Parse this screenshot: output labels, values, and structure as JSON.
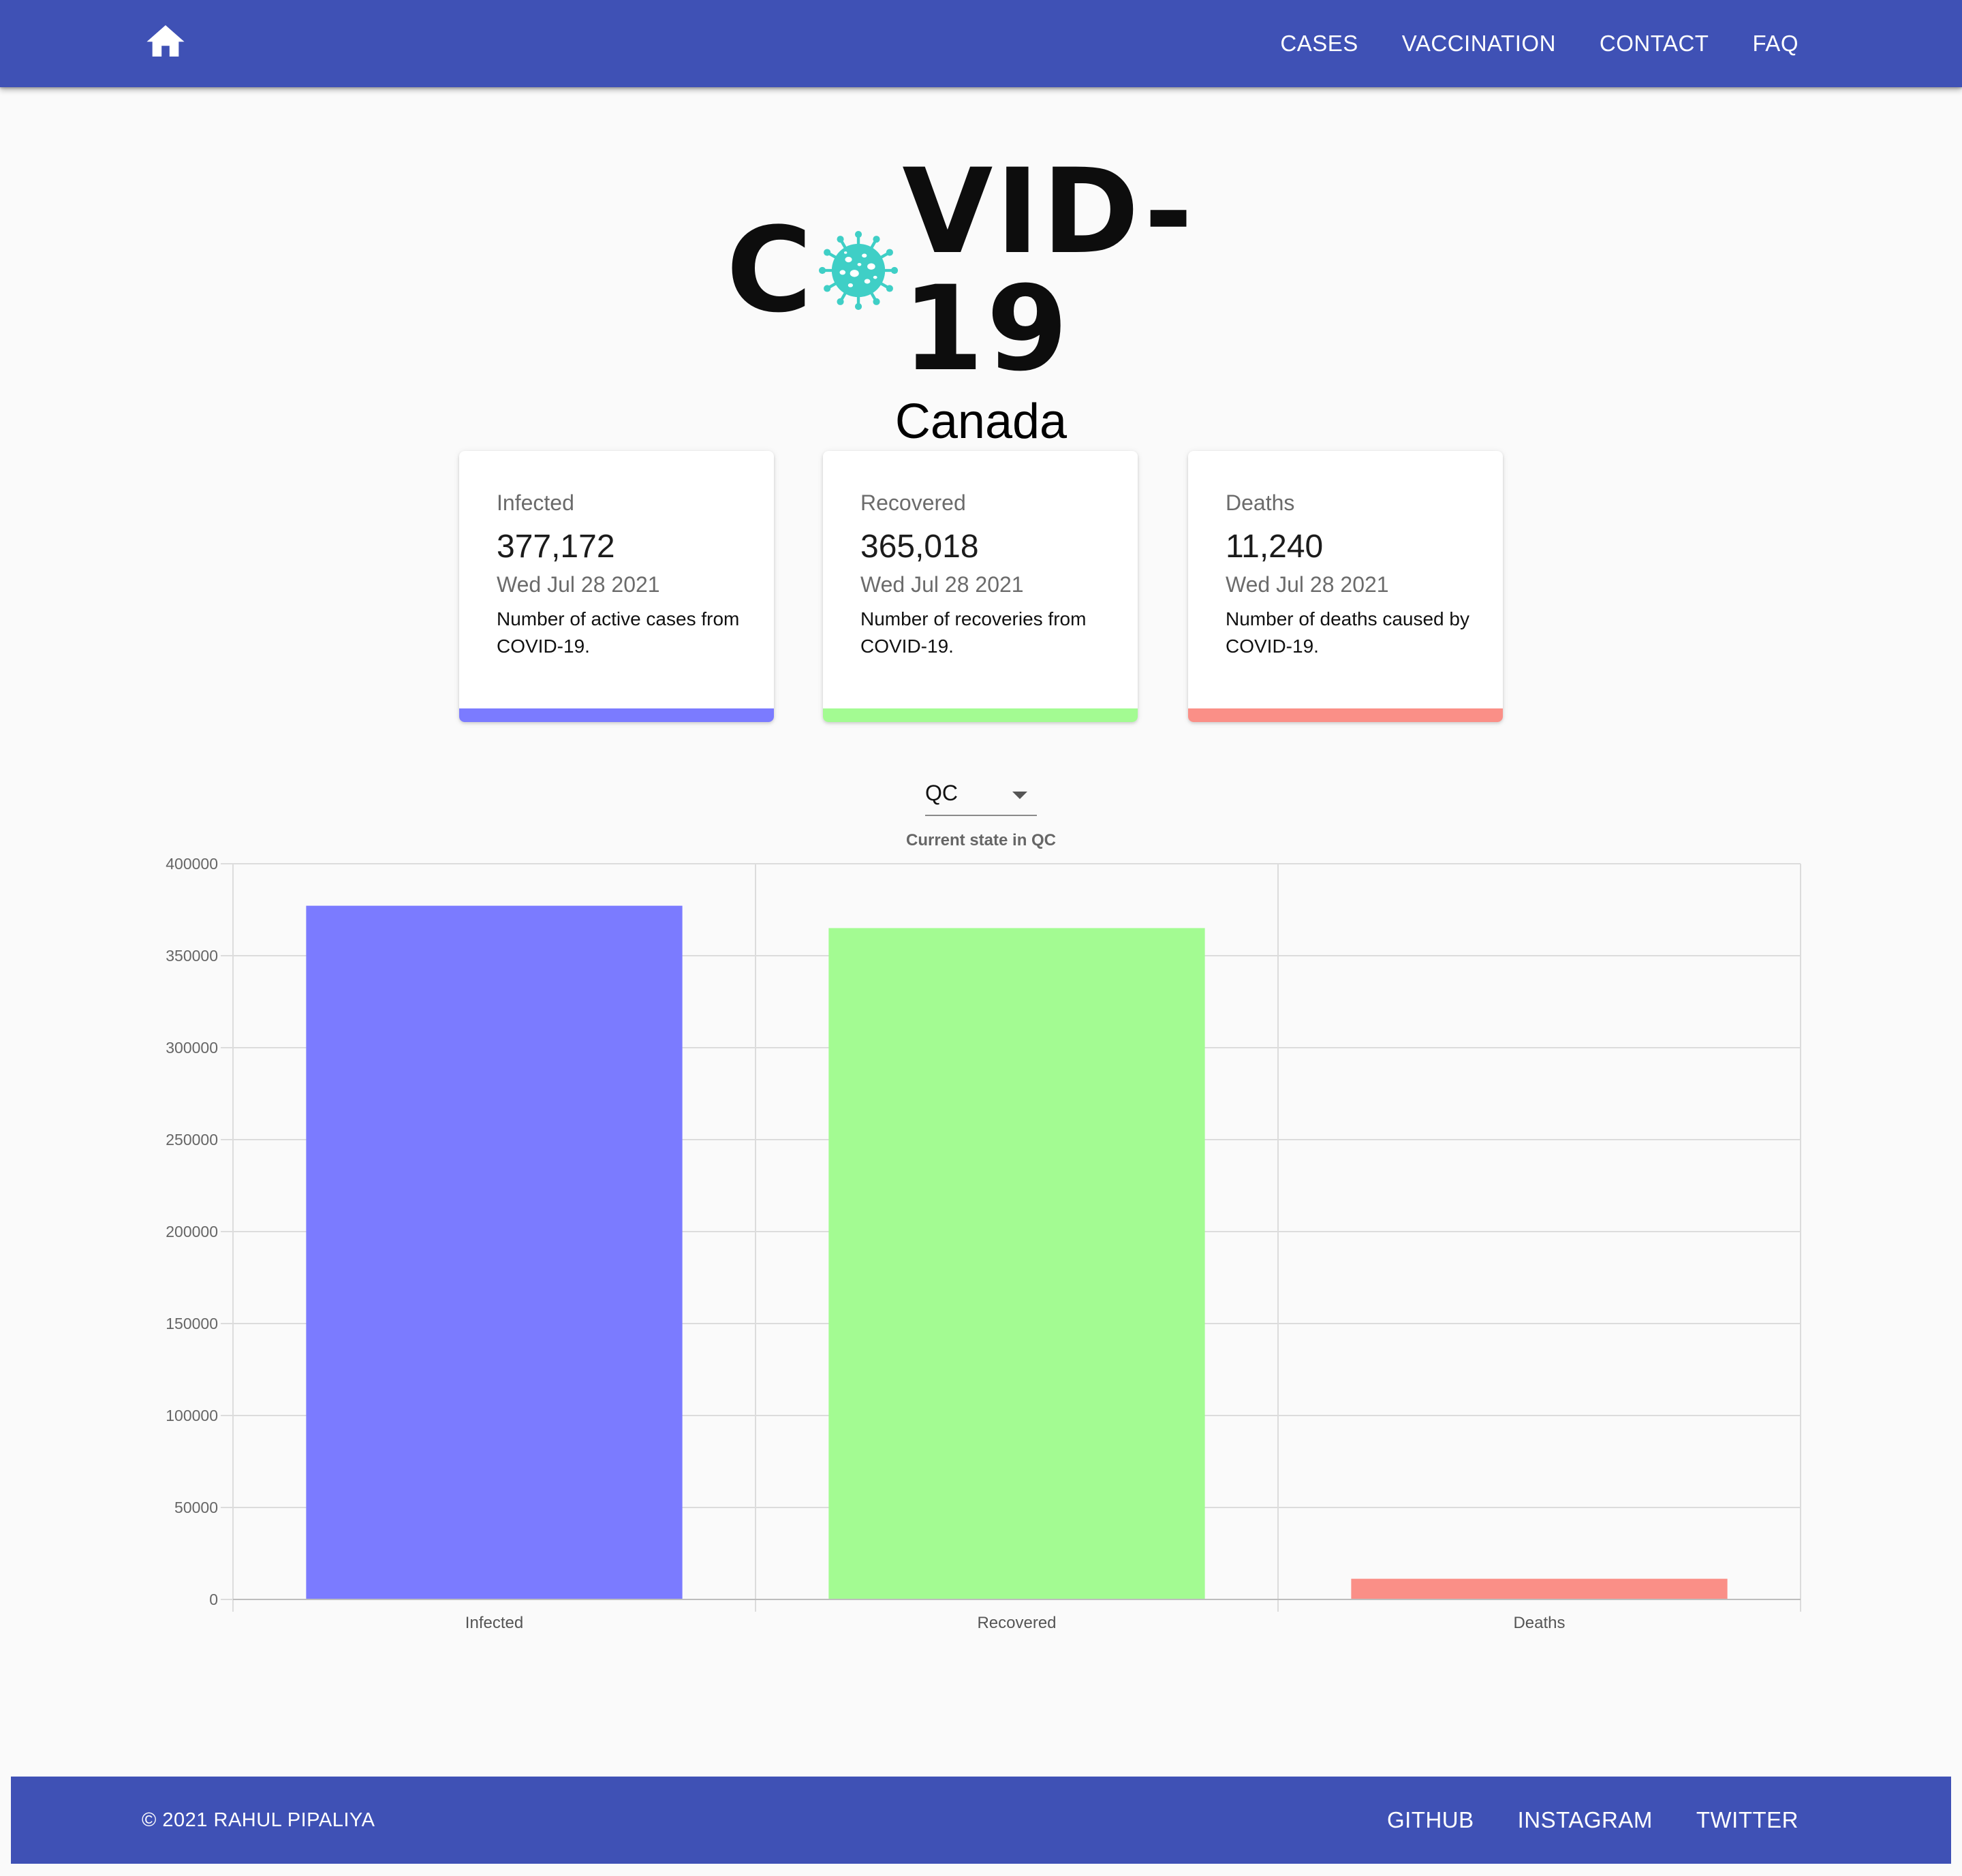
{
  "nav": {
    "home_icon": "home-icon",
    "links": [
      "CASES",
      "VACCINATION",
      "CONTACT",
      "FAQ"
    ]
  },
  "logo": {
    "text_before": "C",
    "text_after": "VID-19",
    "icon": "virus-icon",
    "icon_color": "#3fcfc6"
  },
  "country": "Canada",
  "cards": [
    {
      "title": "Infected",
      "value": "377,172",
      "date": "Wed Jul 28 2021",
      "description": "Number of active cases from COVID-19.",
      "color": "#7b7bff"
    },
    {
      "title": "Recovered",
      "value": "365,018",
      "date": "Wed Jul 28 2021",
      "description": "Number of recoveries from COVID-19.",
      "color": "#a3fb92"
    },
    {
      "title": "Deaths",
      "value": "11,240",
      "date": "Wed Jul 28 2021",
      "description": "Number of deaths caused by COVID-19.",
      "color": "#fa8f87"
    }
  ],
  "region_select": {
    "value": "QC"
  },
  "chart_data": {
    "type": "bar",
    "title": "Current state in QC",
    "categories": [
      "Infected",
      "Recovered",
      "Deaths"
    ],
    "values": [
      377172,
      365018,
      11240
    ],
    "colors": [
      "#7b7bff",
      "#a3fb92",
      "#fa8f87"
    ],
    "ylim": [
      0,
      400000
    ],
    "yticks": [
      0,
      50000,
      100000,
      150000,
      200000,
      250000,
      300000,
      350000,
      400000
    ],
    "grid": true,
    "legend": "none"
  },
  "footer": {
    "copyright": "© 2021 RAHUL PIPALIYA",
    "links": [
      "GITHUB",
      "INSTAGRAM",
      "TWITTER"
    ]
  }
}
